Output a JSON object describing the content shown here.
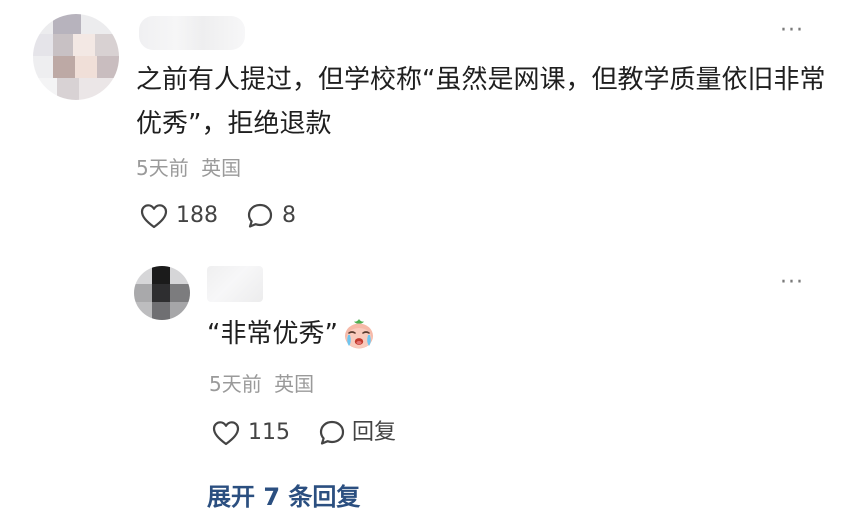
{
  "comment": {
    "text": "之前有人提过，但学校称“虽然是网课，但教学质量依旧非常优秀”，拒绝退款",
    "time": "5天前",
    "location": "英国",
    "likes": "188",
    "replies": "8",
    "more_label": "···"
  },
  "reply": {
    "text": "“非常优秀”",
    "emoji": "crying-face-emoji",
    "time": "5天前",
    "location": "英国",
    "likes": "115",
    "reply_label": "回复",
    "more_label": "···"
  },
  "expand_label": "展开 7 条回复",
  "colors": {
    "text": "#1f1f1f",
    "meta": "#9a9a9a",
    "link": "#2b4f80"
  }
}
